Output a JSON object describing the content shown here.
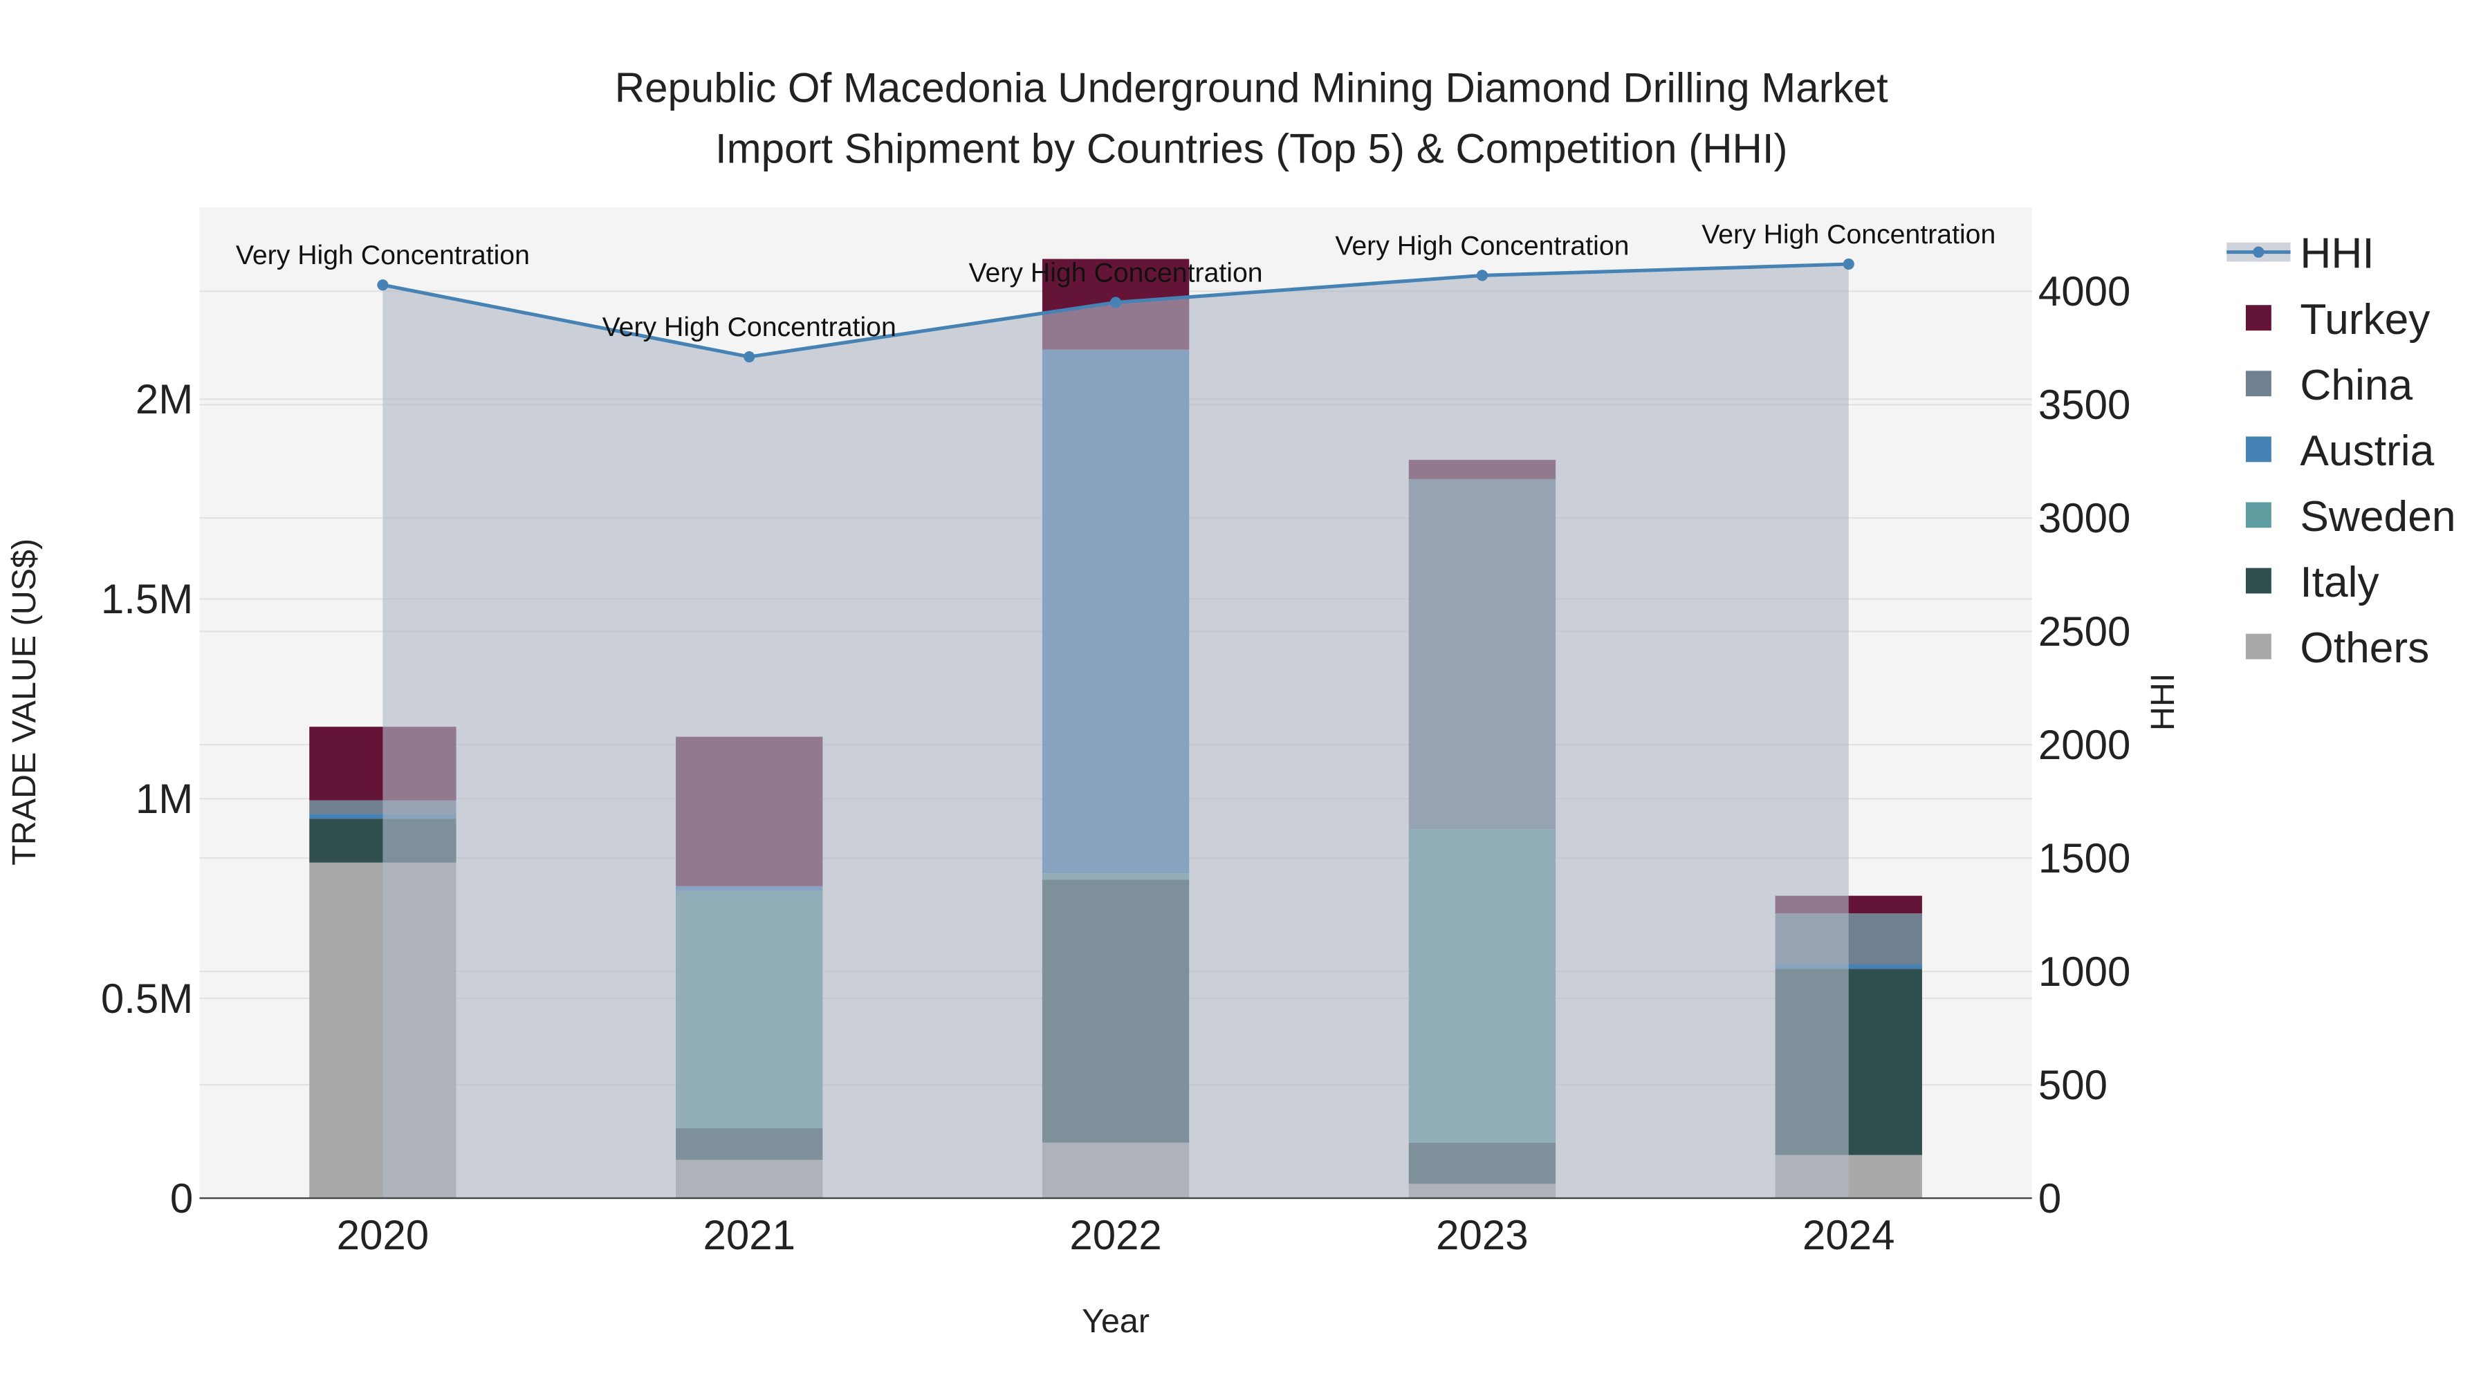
{
  "chart_data": {
    "type": "bar",
    "stacked": true,
    "title": "Republic Of Macedonia Underground Mining Diamond Drilling Market",
    "subtitle": "Import Shipment by Countries (Top 5) & Competition (HHI)",
    "xlabel": "Year",
    "ylabel": "TRADE VALUE (US$)",
    "y2label": "HHI",
    "categories": [
      "2020",
      "2021",
      "2022",
      "2023",
      "2024"
    ],
    "ylim": [
      0,
      2480000
    ],
    "y2lim": [
      0,
      4370
    ],
    "yticks": [
      {
        "v": 0,
        "label": "0"
      },
      {
        "v": 500000,
        "label": "0.5M"
      },
      {
        "v": 1000000,
        "label": "1M"
      },
      {
        "v": 1500000,
        "label": "1.5M"
      },
      {
        "v": 2000000,
        "label": "2M"
      }
    ],
    "y2ticks": [
      0,
      500,
      1000,
      1500,
      2000,
      2500,
      3000,
      3500,
      4000
    ],
    "grid": true,
    "legend_position": "right",
    "series": [
      {
        "name": "Others",
        "color": "#a9a9a9",
        "values": [
          840000,
          96000,
          139000,
          36000,
          108000
        ]
      },
      {
        "name": "Italy",
        "color": "#2f4f4f",
        "values": [
          110000,
          79000,
          658000,
          103000,
          466000
        ]
      },
      {
        "name": "Sweden",
        "color": "#5f9ea0",
        "values": [
          0,
          594000,
          16000,
          785000,
          0
        ]
      },
      {
        "name": "Austria",
        "color": "#4682b4",
        "values": [
          12000,
          12000,
          1311000,
          0,
          12000
        ]
      },
      {
        "name": "China",
        "color": "#708090",
        "values": [
          34000,
          0,
          0,
          876000,
          127000
        ]
      },
      {
        "name": "Turkey",
        "color": "#641436",
        "values": [
          184000,
          374000,
          227000,
          48000,
          44000
        ]
      }
    ],
    "hhi": {
      "name": "HHI",
      "color": "#4682b4",
      "values": [
        4028,
        3711,
        3951,
        4070,
        4120
      ],
      "annotations": [
        "Very High Concentration",
        "Very High Concentration",
        "Very High Concentration",
        "Very High Concentration",
        "Very High Concentration"
      ]
    },
    "legend_order": [
      "HHI",
      "Turkey",
      "China",
      "Austria",
      "Sweden",
      "Italy",
      "Others"
    ]
  }
}
